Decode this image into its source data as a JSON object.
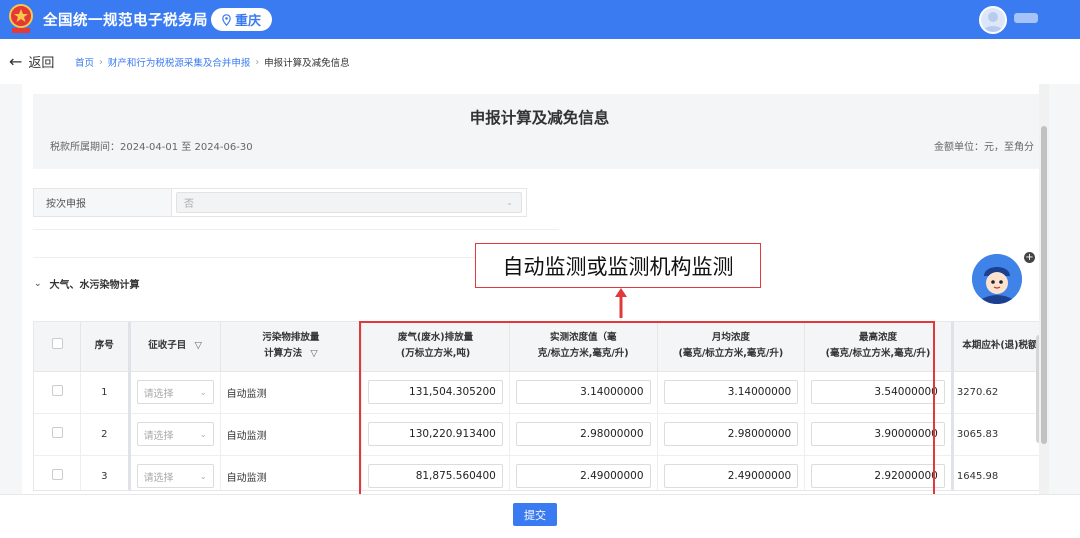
{
  "header": {
    "site_title": "全国统一规范电子税务局",
    "region": "重庆"
  },
  "nav": {
    "back_label": "返回",
    "breadcrumb": [
      "首页",
      "财产和行为税税源采集及合并申报",
      "申报计算及减免信息"
    ]
  },
  "page": {
    "title": "申报计算及减免信息",
    "tax_period": "税款所属期间：2024-04-01 至 2024-06-30",
    "amount_unit": "金额单位：元，至角分"
  },
  "form": {
    "label": "按次申报",
    "value": "否"
  },
  "section": {
    "title": "大气、水污染物计算"
  },
  "callout": {
    "text": "自动监测或监测机构监测"
  },
  "table": {
    "headers": {
      "seq": "序号",
      "item": "征收子目",
      "method_line1": "污染物排放量",
      "method_line2": "计算方法",
      "volume_line1": "废气(废水)排放量",
      "volume_line2": "(万标立方米,吨)",
      "measured_line1": "实测浓度值（毫",
      "measured_line2": "克/标立方米,毫克/升)",
      "monthly_line1": "月均浓度",
      "monthly_line2": "(毫克/标立方米,毫克/升)",
      "max_line1": "最高浓度",
      "max_line2": "(毫克/标立方米,毫克/升)",
      "tax": "本期应补(退)税额"
    },
    "select_placeholder": "请选择",
    "rows": [
      {
        "seq": "1",
        "method": "自动监测",
        "volume": "131,504.305200",
        "measured": "3.14000000",
        "monthly": "3.14000000",
        "max": "3.54000000",
        "tax": "3270.62"
      },
      {
        "seq": "2",
        "method": "自动监测",
        "volume": "130,220.913400",
        "measured": "2.98000000",
        "monthly": "2.98000000",
        "max": "3.90000000",
        "tax": "3065.83"
      },
      {
        "seq": "3",
        "method": "自动监测",
        "volume": "81,875.560400",
        "measured": "2.49000000",
        "monthly": "2.49000000",
        "max": "2.92000000",
        "tax": "1645.98"
      }
    ]
  },
  "footer": {
    "submit_label": "提交"
  },
  "colors": {
    "brand_blue": "#3b7bf2",
    "highlight_red": "#e0383b"
  }
}
